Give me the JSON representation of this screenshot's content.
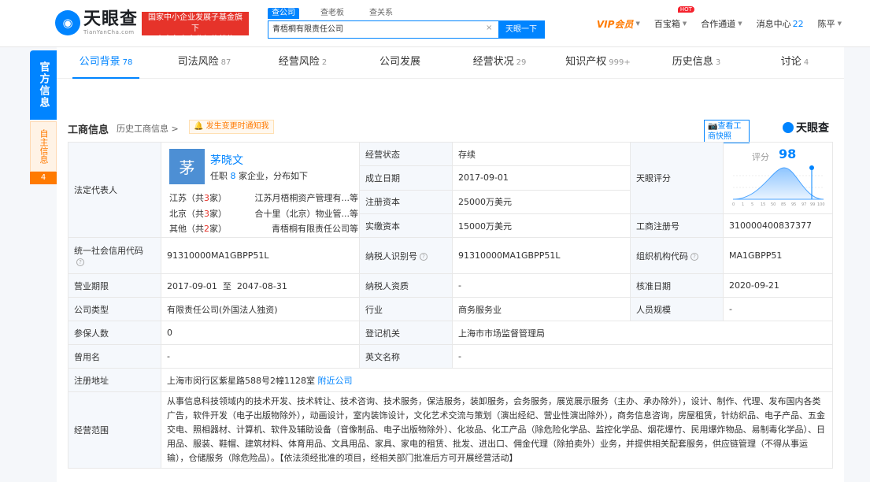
{
  "header": {
    "logo_cn": "天眼查",
    "logo_en": "TianYanCha.com",
    "badge_line1": "国家中小企业发展子基金旗下",
    "badge_line2": "官方备案企业征信机构",
    "search_tabs": [
      "查公司",
      "查老板",
      "查关系"
    ],
    "search_value": "青梧桐有限责任公司",
    "search_button": "天眼一下",
    "vip": "VIP会员",
    "baobao": "百宝箱",
    "hot": "HOT",
    "cooperation": "合作通道",
    "messages_label": "消息中心",
    "messages_count": "22",
    "user": "陈平"
  },
  "sidebar": {
    "official": "官方信息",
    "self": "自主信息",
    "self_count": "4"
  },
  "tabs": [
    {
      "label": "公司背景",
      "count": "78"
    },
    {
      "label": "司法风险",
      "count": "87"
    },
    {
      "label": "经营风险",
      "count": "2"
    },
    {
      "label": "公司发展",
      "count": ""
    },
    {
      "label": "经营状况",
      "count": "29"
    },
    {
      "label": "知识产权",
      "count": "999+"
    },
    {
      "label": "历史信息",
      "count": "3"
    },
    {
      "label": "讨论",
      "count": "4"
    }
  ],
  "section": {
    "title": "工商信息",
    "history": "历史工商信息 >",
    "notify": "发生变更时通知我",
    "snapshot": "查看工商快照",
    "watermark": "天眼查"
  },
  "legal_rep": {
    "label": "法定代表人",
    "avatar": "茅",
    "name": "茅晓文",
    "sub_prefix": "任职",
    "sub_count": "8",
    "sub_suffix": "家企业，分布如下",
    "lines": [
      {
        "region": "江苏（共",
        "num": "3",
        "unit": "家）",
        "company": "江苏月梧桐资产管理有...等"
      },
      {
        "region": "北京（共",
        "num": "3",
        "unit": "家）",
        "company": "合十里（北京）物业管...等"
      },
      {
        "region": "其他（共",
        "num": "2",
        "unit": "家）",
        "company": "青梧桐有限责任公司等"
      }
    ]
  },
  "score": {
    "label": "天眼评分",
    "title": "评分",
    "value": "98",
    "axis": [
      "0",
      "1",
      "5",
      "15",
      "50",
      "85",
      "95",
      "97",
      "99",
      "100"
    ]
  },
  "fields": {
    "status_label": "经营状态",
    "status": "存续",
    "founded_label": "成立日期",
    "founded": "2017-09-01",
    "reg_capital_label": "注册资本",
    "reg_capital": "25000万美元",
    "paid_capital_label": "实缴资本",
    "paid_capital": "15000万美元",
    "reg_no_label": "工商注册号",
    "reg_no": "310000400837377",
    "credit_code_label": "统一社会信用代码",
    "credit_code": "91310000MA1GBPP51L",
    "tax_id_label": "纳税人识别号",
    "tax_id": "91310000MA1GBPP51L",
    "org_code_label": "组织机构代码",
    "org_code": "MA1GBPP51",
    "term_label": "营业期限",
    "term": "2017-09-01  至  2047-08-31",
    "tax_qual_label": "纳税人资质",
    "tax_qual": "-",
    "approve_label": "核准日期",
    "approve": "2020-09-21",
    "type_label": "公司类型",
    "type": "有限责任公司(外国法人独资)",
    "industry_label": "行业",
    "industry": "商务服务业",
    "staff_label": "人员规模",
    "staff": "-",
    "insured_label": "参保人数",
    "insured": "0",
    "authority_label": "登记机关",
    "authority": "上海市市场监督管理局",
    "former_label": "曾用名",
    "former": "-",
    "en_name_label": "英文名称",
    "en_name": "-",
    "address_label": "注册地址",
    "address": "上海市闵行区紫星路588号2幢1128室",
    "nearby": "附近公司",
    "scope_label": "经营范围",
    "scope": "从事信息科技领域内的技术开发、技术转让、技术咨询、技术服务，保洁服务，装卸服务，会务服务，展览展示服务（主办、承办除外），设计、制作、代理、发布国内各类广告，软件开发（电子出版物除外），动画设计，室内装饰设计，文化艺术交流与策划（演出经纪、营业性演出除外），商务信息咨询，房屋租赁，针纺织品、电子产品、五金交电、照相器材、计算机、软件及辅助设备（音像制品、电子出版物除外）、化妆品、化工产品（除危险化学品、监控化学品、烟花爆竹、民用爆炸物品、易制毒化学品）、日用品、服装、鞋帽、建筑材料、体育用品、文具用品、家具、家电的租赁、批发、进出口、佣金代理（除拍卖外）业务，并提供相关配套服务，供应链管理（不得从事运输），仓储服务（除危险品）。【依法须经批准的项目，经相关部门批准后方可开展经营活动】"
  }
}
